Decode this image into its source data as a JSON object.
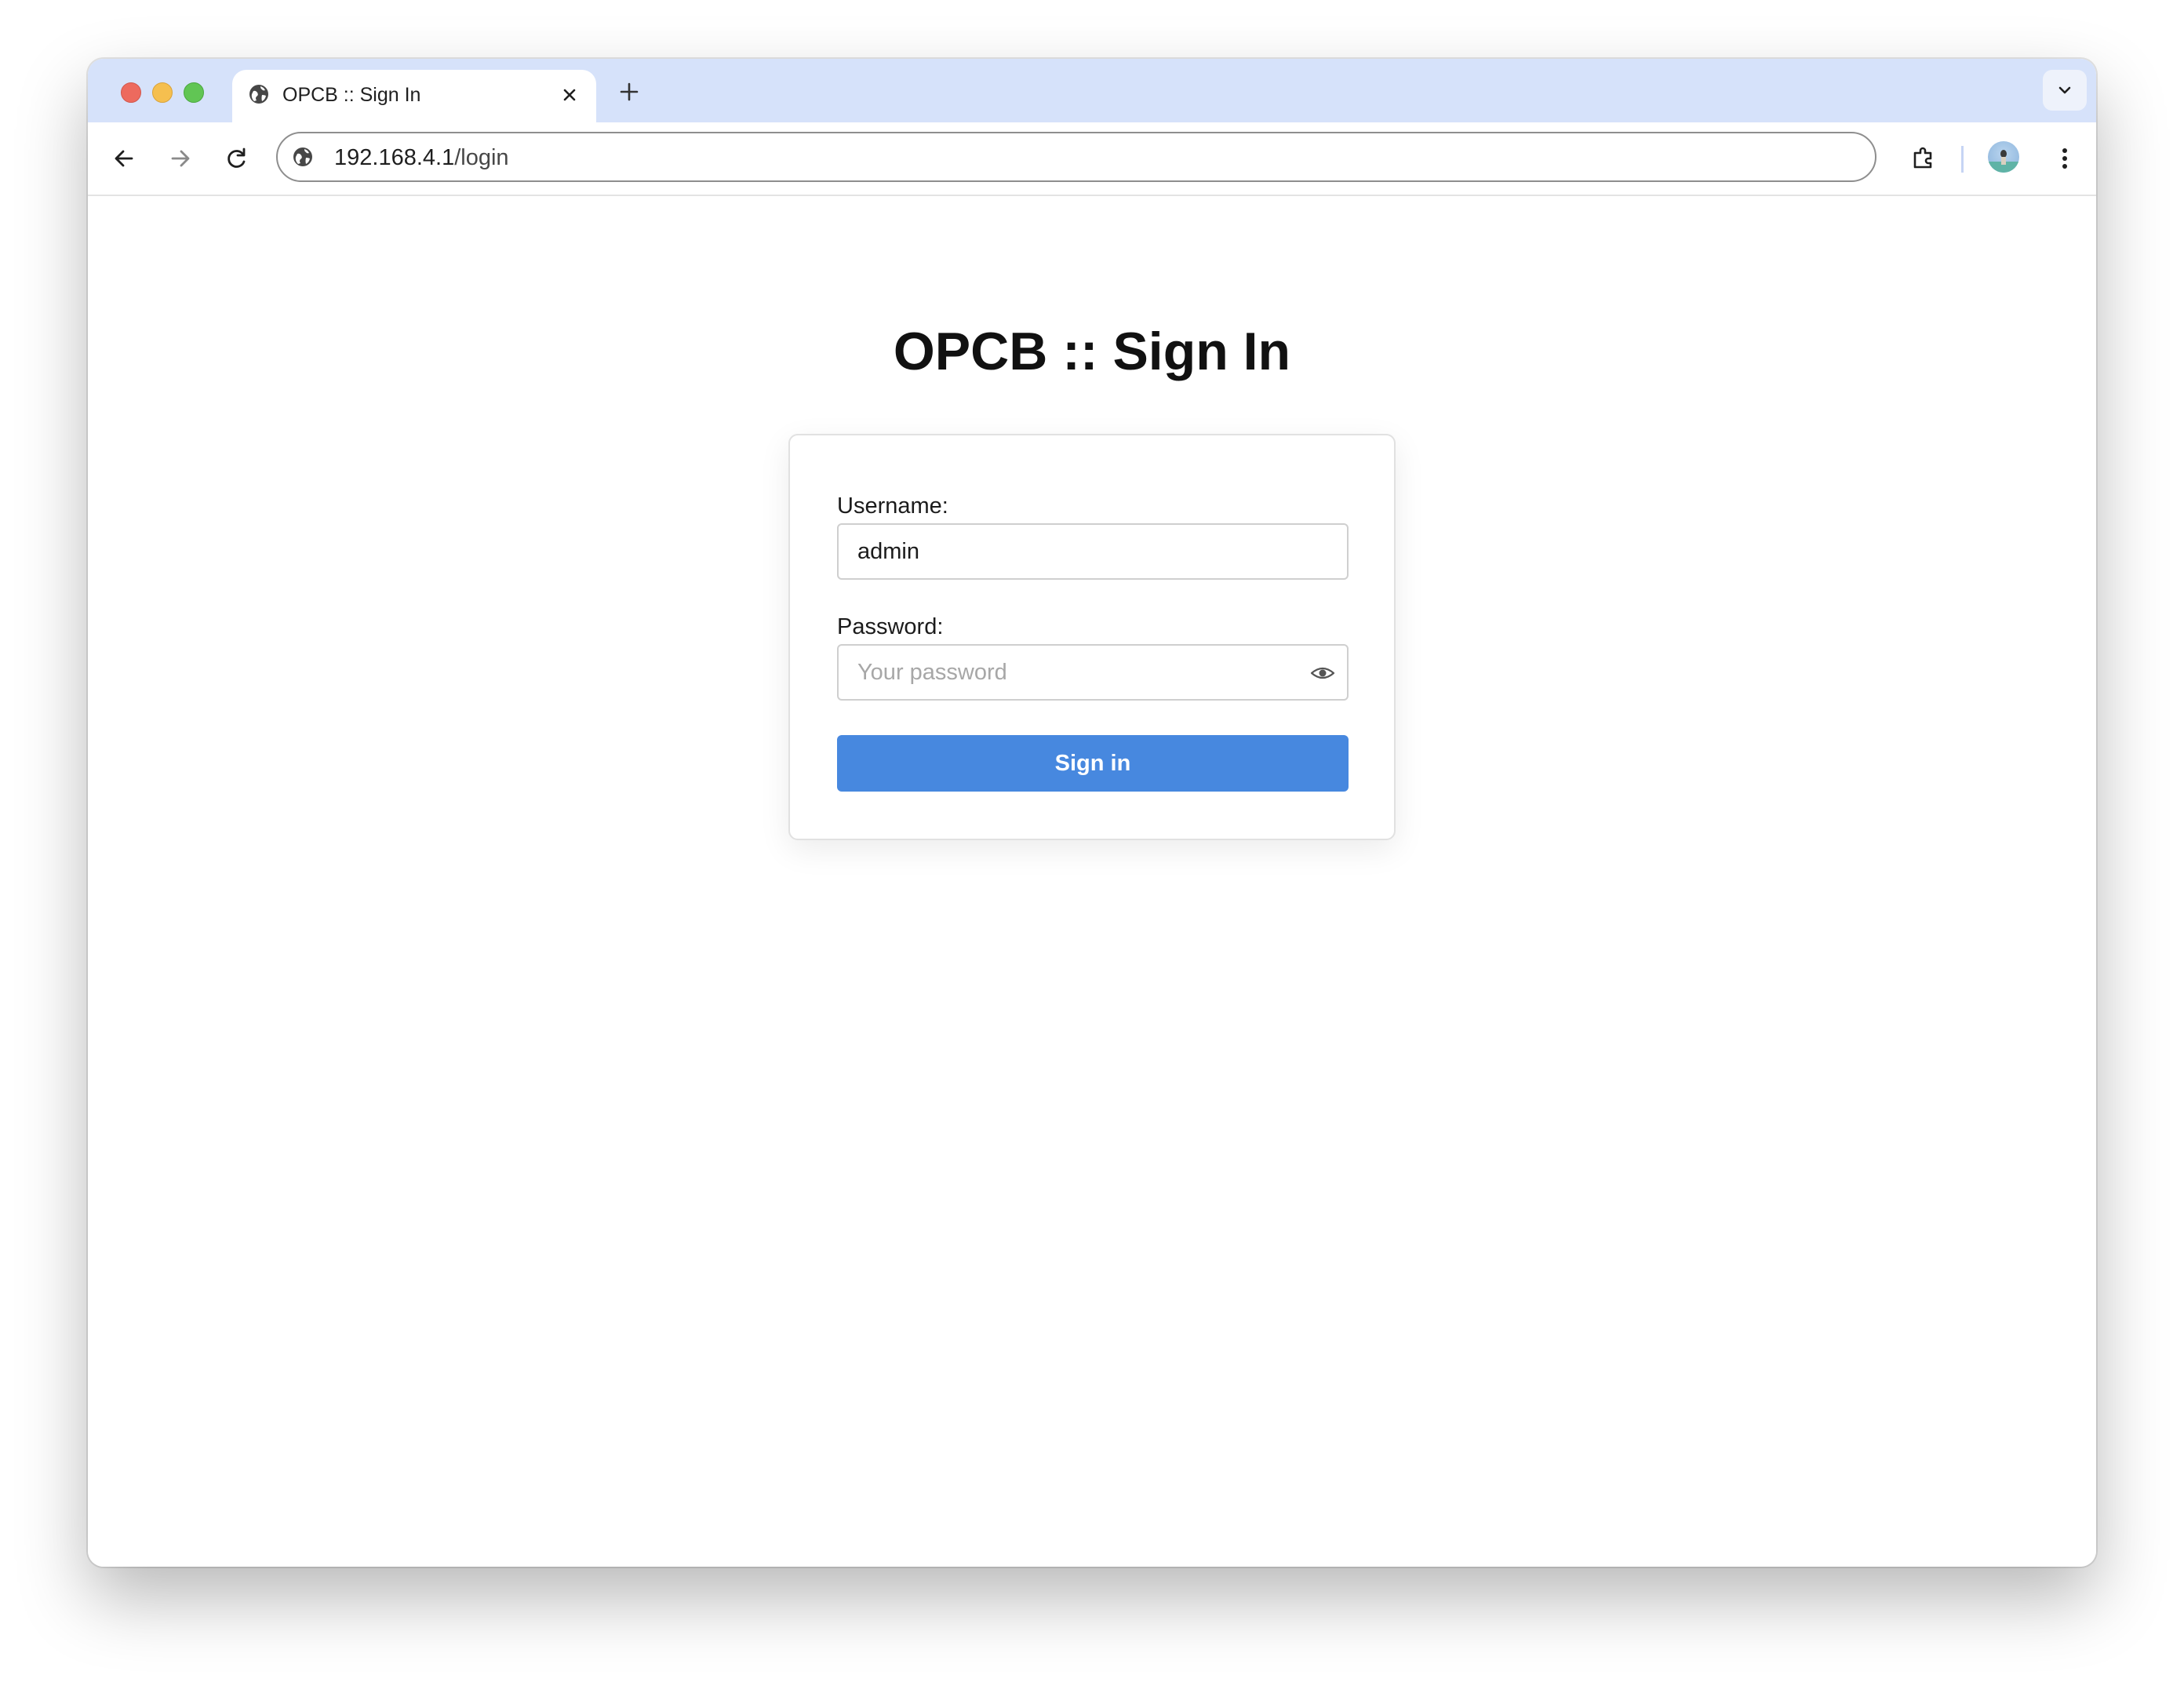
{
  "browser": {
    "tab": {
      "title": "OPCB :: Sign In",
      "icon": "globe-icon"
    },
    "address_bar": {
      "host": "192.168.4.1",
      "path": "/login"
    },
    "accent_color": "#d6e2fa"
  },
  "page": {
    "title": "OPCB :: Sign In",
    "form": {
      "username_label": "Username:",
      "username_value": "admin",
      "password_label": "Password:",
      "password_placeholder": "Your password",
      "submit_label": "Sign in",
      "submit_color": "#4788df"
    }
  }
}
